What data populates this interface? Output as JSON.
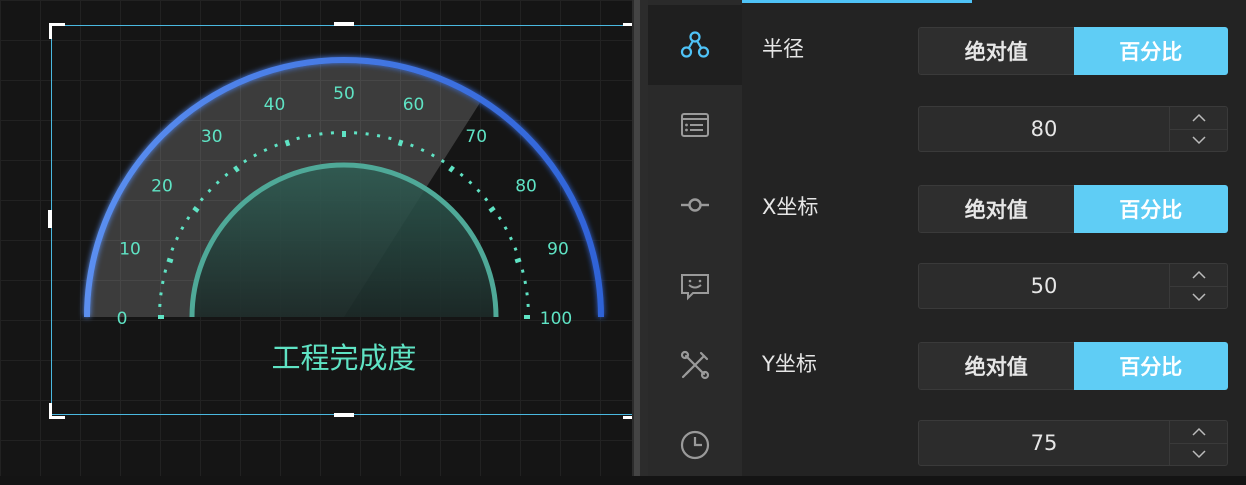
{
  "gauge": {
    "title": "工程完成度",
    "ticks": [
      "0",
      "10",
      "20",
      "30",
      "40",
      "50",
      "60",
      "70",
      "80",
      "90",
      "100"
    ],
    "value": 68,
    "colors": {
      "arc": "#3a6fe0",
      "tick": "#5fe3c4",
      "inner_arc": "#4fa998",
      "title": "#5fe3c4"
    }
  },
  "sidebar": {
    "icons": [
      "share-nodes-icon",
      "list-card-icon",
      "commit-node-icon",
      "chat-bubble-icon",
      "tools-icon",
      "clock-icon"
    ],
    "active_index": 0
  },
  "props": {
    "radius": {
      "label": "半径",
      "options": [
        "绝对值",
        "百分比"
      ],
      "selected": "百分比",
      "value": "80"
    },
    "x": {
      "label": "X坐标",
      "options": [
        "绝对值",
        "百分比"
      ],
      "selected": "百分比",
      "value": "50"
    },
    "y": {
      "label": "Y坐标",
      "options": [
        "绝对值",
        "百分比"
      ],
      "selected": "百分比",
      "value": "75"
    }
  },
  "accent": "#5fcdf5"
}
